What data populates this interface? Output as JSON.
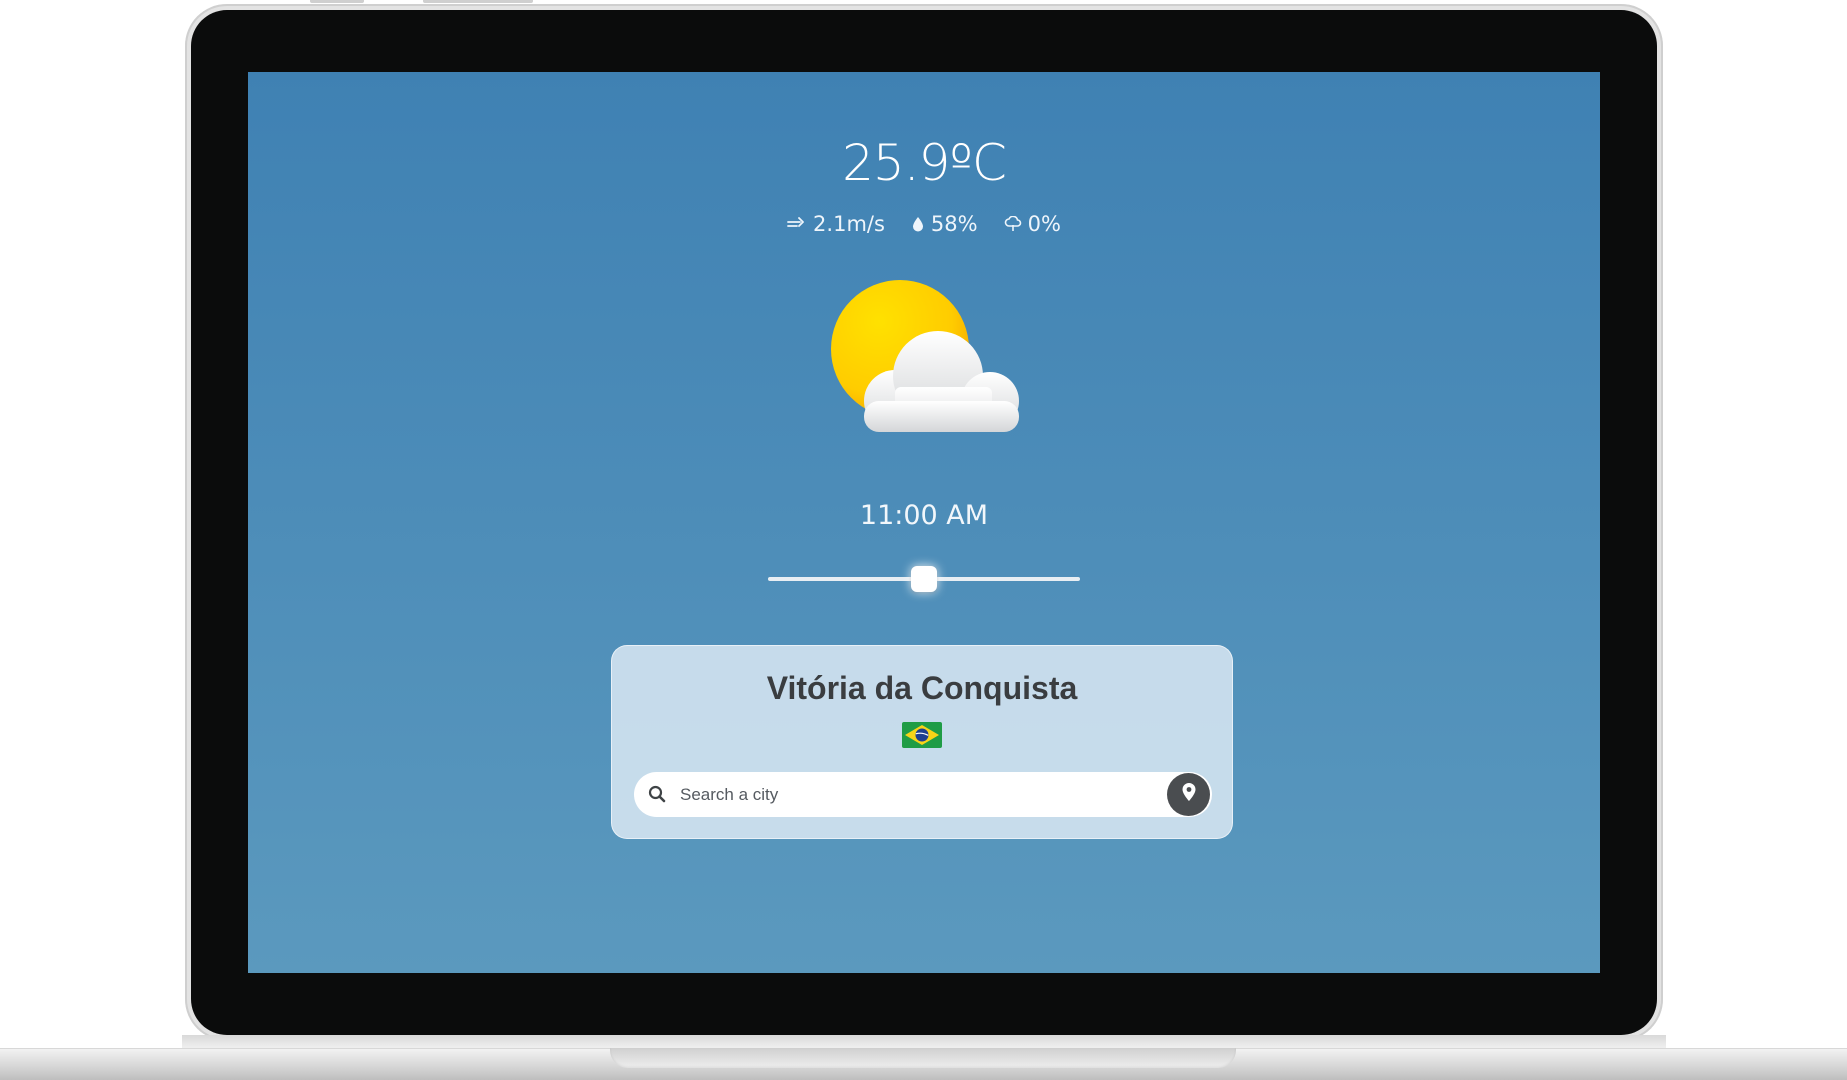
{
  "weather": {
    "temperature": "25.9ºC",
    "wind": "2.1m/s",
    "humidity": "58%",
    "precipitation": "0%",
    "condition_icon": "partly-cloudy-icon"
  },
  "time": {
    "label": "11:00 AM",
    "slider_fraction": 0.5
  },
  "location": {
    "city": "Vitória da Conquista",
    "country_flag_icon": "brazil-flag-icon"
  },
  "search": {
    "placeholder": "Search a city",
    "value": ""
  },
  "icons": {
    "wind": "wind-icon",
    "humidity": "droplet-icon",
    "precipitation": "rain-cloud-icon",
    "search": "search-icon",
    "location": "map-pin-icon"
  },
  "colors": {
    "background_top": "#3f81b3",
    "background_bottom": "#5b99be",
    "card": "#dceaf4",
    "location_button": "#4a4d50"
  }
}
